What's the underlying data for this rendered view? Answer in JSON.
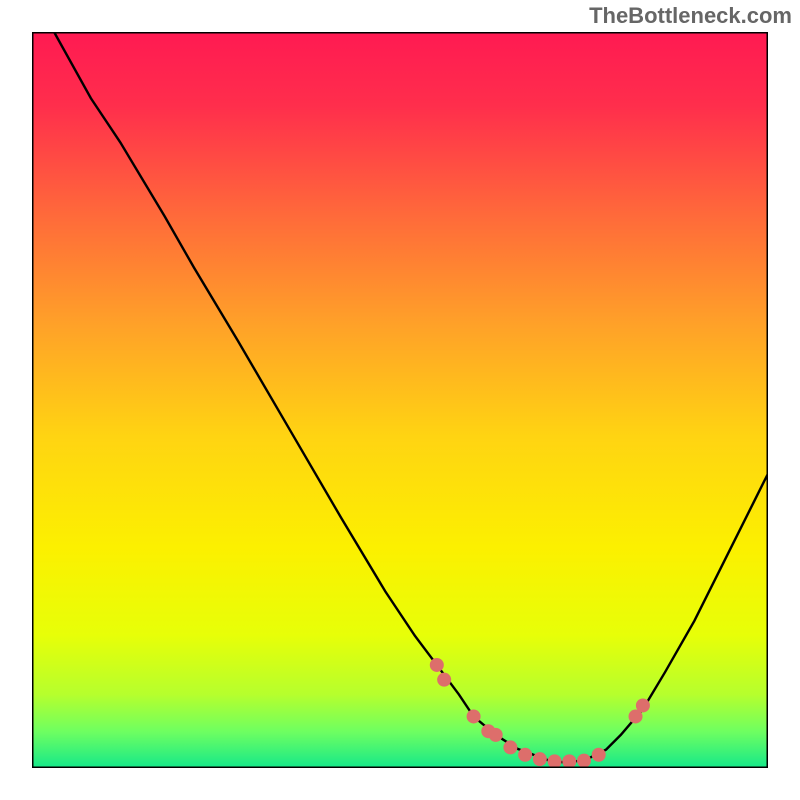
{
  "watermark": "TheBottleneck.com",
  "chart_data": {
    "type": "line",
    "title": "",
    "xlabel": "",
    "ylabel": "",
    "xlim": [
      0,
      100
    ],
    "ylim": [
      0,
      100
    ],
    "grid": false,
    "background": "gradient green-yellow-red",
    "series": [
      {
        "name": "curve",
        "x": [
          3,
          8,
          12,
          18,
          22,
          28,
          35,
          42,
          48,
          52,
          55,
          58,
          60,
          63,
          66,
          70,
          72,
          75,
          78,
          80,
          83,
          86,
          90,
          94,
          98,
          100
        ],
        "y": [
          100,
          91,
          85,
          75,
          68,
          58,
          46,
          34,
          24,
          18,
          14,
          10,
          7,
          4.5,
          2.6,
          1.1,
          0.8,
          1.0,
          2.5,
          4.5,
          8,
          13,
          20,
          28,
          36,
          40
        ]
      }
    ],
    "markers": [
      {
        "x": 55,
        "y": 14
      },
      {
        "x": 56,
        "y": 12
      },
      {
        "x": 60,
        "y": 7
      },
      {
        "x": 62,
        "y": 5
      },
      {
        "x": 63,
        "y": 4.5
      },
      {
        "x": 65,
        "y": 2.8
      },
      {
        "x": 67,
        "y": 1.8
      },
      {
        "x": 69,
        "y": 1.2
      },
      {
        "x": 71,
        "y": 0.9
      },
      {
        "x": 73,
        "y": 0.9
      },
      {
        "x": 75,
        "y": 1.0
      },
      {
        "x": 77,
        "y": 1.8
      },
      {
        "x": 82,
        "y": 7.0
      },
      {
        "x": 83,
        "y": 8.5
      }
    ],
    "marker_color": "#dd6e6b"
  }
}
